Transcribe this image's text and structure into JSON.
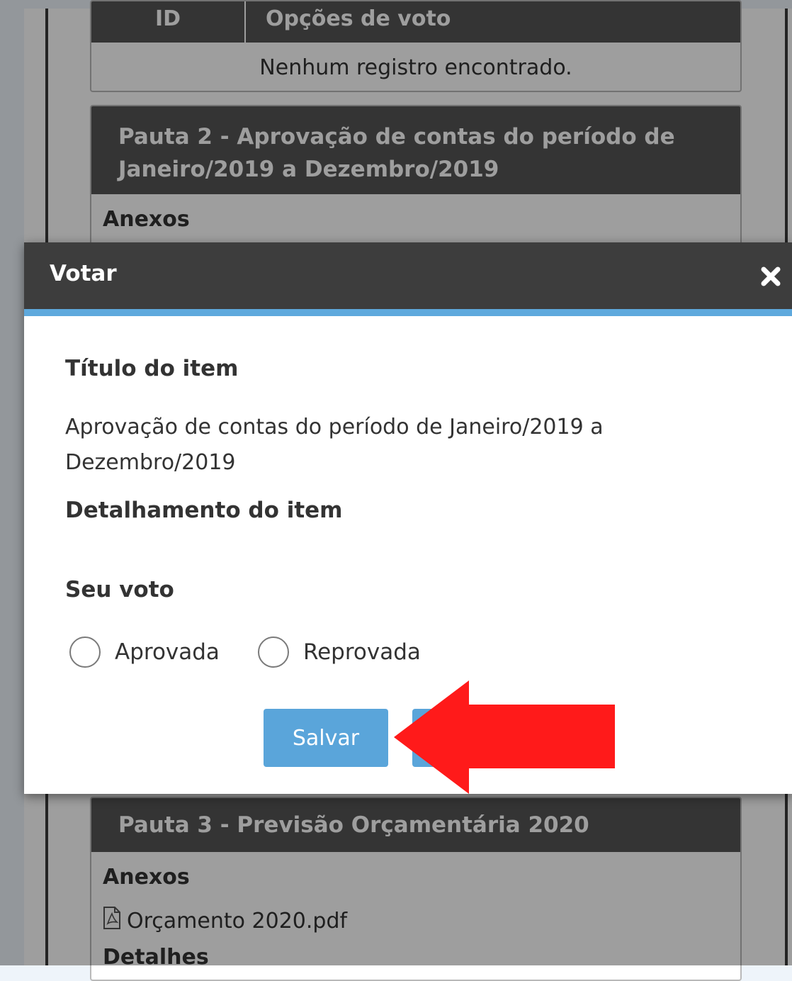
{
  "background": {
    "vote_table": {
      "header_id": "ID",
      "header_options": "Opções de voto",
      "empty_message": "Nenhum registro encontrado."
    },
    "pauta2": {
      "title": "Pauta 2 - Aprovação de contas do período de Janeiro/2019 a Dezembro/2019",
      "attachments_label": "Anexos"
    },
    "pauta3": {
      "title": "Pauta 3 - Previsão Orçamentária 2020",
      "attachments_label": "Anexos",
      "attachment_file": "Orçamento 2020.pdf",
      "details_label": "Detalhes"
    }
  },
  "modal": {
    "title": "Votar",
    "close_icon": "close-icon",
    "item_title_label": "Título do item",
    "item_title_value": "Aprovação de contas do período de Janeiro/2019 a Dezembro/2019",
    "item_detail_label": "Detalhamento do item",
    "vote_label": "Seu voto",
    "options": [
      {
        "label": "Aprovada",
        "selected": false
      },
      {
        "label": "Reprovada",
        "selected": false
      }
    ],
    "save_label": "Salvar"
  },
  "colors": {
    "header_bg": "#3d3d3d",
    "accent": "#5ea9dd",
    "button": "#5aa5da",
    "annotation": "#ff1a1a"
  }
}
